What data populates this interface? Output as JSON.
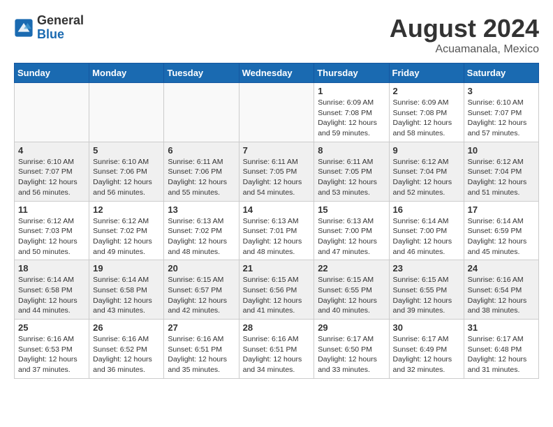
{
  "header": {
    "logo": {
      "general": "General",
      "blue": "Blue"
    },
    "title": "August 2024",
    "location": "Acuamanala, Mexico"
  },
  "weekdays": [
    "Sunday",
    "Monday",
    "Tuesday",
    "Wednesday",
    "Thursday",
    "Friday",
    "Saturday"
  ],
  "weeks": [
    [
      {
        "day": "",
        "info": ""
      },
      {
        "day": "",
        "info": ""
      },
      {
        "day": "",
        "info": ""
      },
      {
        "day": "",
        "info": ""
      },
      {
        "day": "1",
        "info": "Sunrise: 6:09 AM\nSunset: 7:08 PM\nDaylight: 12 hours\nand 59 minutes."
      },
      {
        "day": "2",
        "info": "Sunrise: 6:09 AM\nSunset: 7:08 PM\nDaylight: 12 hours\nand 58 minutes."
      },
      {
        "day": "3",
        "info": "Sunrise: 6:10 AM\nSunset: 7:07 PM\nDaylight: 12 hours\nand 57 minutes."
      }
    ],
    [
      {
        "day": "4",
        "info": "Sunrise: 6:10 AM\nSunset: 7:07 PM\nDaylight: 12 hours\nand 56 minutes."
      },
      {
        "day": "5",
        "info": "Sunrise: 6:10 AM\nSunset: 7:06 PM\nDaylight: 12 hours\nand 56 minutes."
      },
      {
        "day": "6",
        "info": "Sunrise: 6:11 AM\nSunset: 7:06 PM\nDaylight: 12 hours\nand 55 minutes."
      },
      {
        "day": "7",
        "info": "Sunrise: 6:11 AM\nSunset: 7:05 PM\nDaylight: 12 hours\nand 54 minutes."
      },
      {
        "day": "8",
        "info": "Sunrise: 6:11 AM\nSunset: 7:05 PM\nDaylight: 12 hours\nand 53 minutes."
      },
      {
        "day": "9",
        "info": "Sunrise: 6:12 AM\nSunset: 7:04 PM\nDaylight: 12 hours\nand 52 minutes."
      },
      {
        "day": "10",
        "info": "Sunrise: 6:12 AM\nSunset: 7:04 PM\nDaylight: 12 hours\nand 51 minutes."
      }
    ],
    [
      {
        "day": "11",
        "info": "Sunrise: 6:12 AM\nSunset: 7:03 PM\nDaylight: 12 hours\nand 50 minutes."
      },
      {
        "day": "12",
        "info": "Sunrise: 6:12 AM\nSunset: 7:02 PM\nDaylight: 12 hours\nand 49 minutes."
      },
      {
        "day": "13",
        "info": "Sunrise: 6:13 AM\nSunset: 7:02 PM\nDaylight: 12 hours\nand 48 minutes."
      },
      {
        "day": "14",
        "info": "Sunrise: 6:13 AM\nSunset: 7:01 PM\nDaylight: 12 hours\nand 48 minutes."
      },
      {
        "day": "15",
        "info": "Sunrise: 6:13 AM\nSunset: 7:00 PM\nDaylight: 12 hours\nand 47 minutes."
      },
      {
        "day": "16",
        "info": "Sunrise: 6:14 AM\nSunset: 7:00 PM\nDaylight: 12 hours\nand 46 minutes."
      },
      {
        "day": "17",
        "info": "Sunrise: 6:14 AM\nSunset: 6:59 PM\nDaylight: 12 hours\nand 45 minutes."
      }
    ],
    [
      {
        "day": "18",
        "info": "Sunrise: 6:14 AM\nSunset: 6:58 PM\nDaylight: 12 hours\nand 44 minutes."
      },
      {
        "day": "19",
        "info": "Sunrise: 6:14 AM\nSunset: 6:58 PM\nDaylight: 12 hours\nand 43 minutes."
      },
      {
        "day": "20",
        "info": "Sunrise: 6:15 AM\nSunset: 6:57 PM\nDaylight: 12 hours\nand 42 minutes."
      },
      {
        "day": "21",
        "info": "Sunrise: 6:15 AM\nSunset: 6:56 PM\nDaylight: 12 hours\nand 41 minutes."
      },
      {
        "day": "22",
        "info": "Sunrise: 6:15 AM\nSunset: 6:55 PM\nDaylight: 12 hours\nand 40 minutes."
      },
      {
        "day": "23",
        "info": "Sunrise: 6:15 AM\nSunset: 6:55 PM\nDaylight: 12 hours\nand 39 minutes."
      },
      {
        "day": "24",
        "info": "Sunrise: 6:16 AM\nSunset: 6:54 PM\nDaylight: 12 hours\nand 38 minutes."
      }
    ],
    [
      {
        "day": "25",
        "info": "Sunrise: 6:16 AM\nSunset: 6:53 PM\nDaylight: 12 hours\nand 37 minutes."
      },
      {
        "day": "26",
        "info": "Sunrise: 6:16 AM\nSunset: 6:52 PM\nDaylight: 12 hours\nand 36 minutes."
      },
      {
        "day": "27",
        "info": "Sunrise: 6:16 AM\nSunset: 6:51 PM\nDaylight: 12 hours\nand 35 minutes."
      },
      {
        "day": "28",
        "info": "Sunrise: 6:16 AM\nSunset: 6:51 PM\nDaylight: 12 hours\nand 34 minutes."
      },
      {
        "day": "29",
        "info": "Sunrise: 6:17 AM\nSunset: 6:50 PM\nDaylight: 12 hours\nand 33 minutes."
      },
      {
        "day": "30",
        "info": "Sunrise: 6:17 AM\nSunset: 6:49 PM\nDaylight: 12 hours\nand 32 minutes."
      },
      {
        "day": "31",
        "info": "Sunrise: 6:17 AM\nSunset: 6:48 PM\nDaylight: 12 hours\nand 31 minutes."
      }
    ]
  ]
}
